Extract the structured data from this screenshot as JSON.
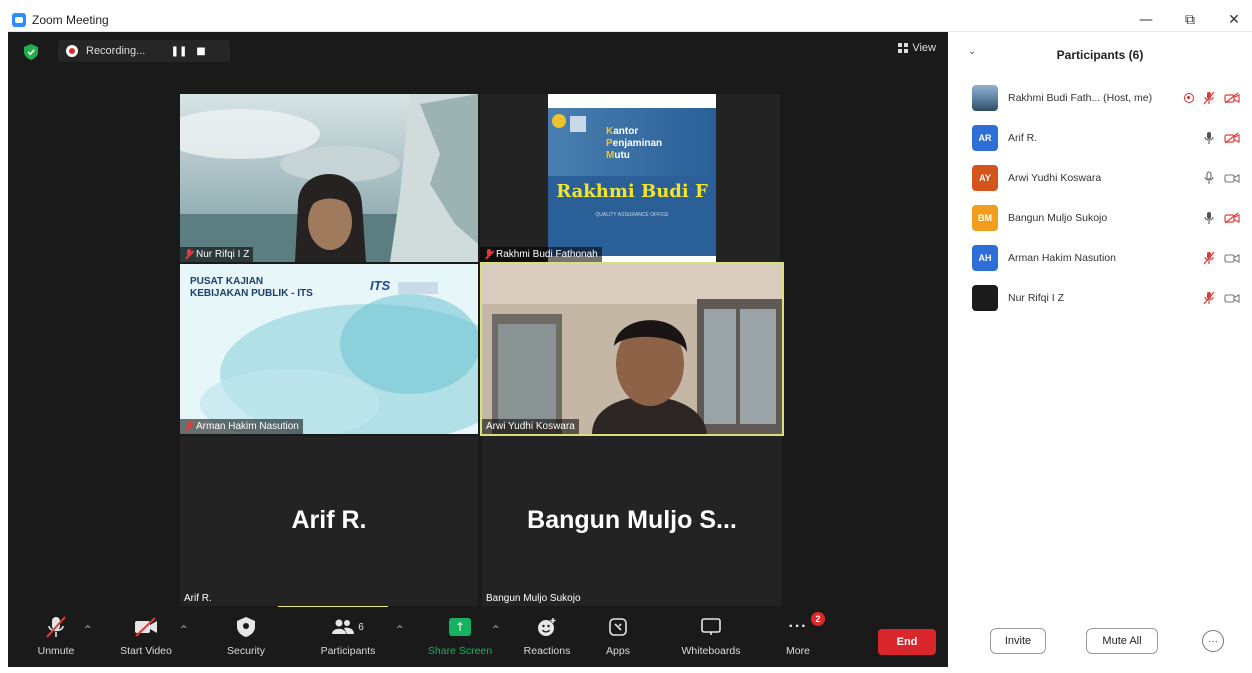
{
  "window": {
    "title": "Zoom Meeting",
    "controls": {
      "minimize": "—",
      "restore": "⧉",
      "close": "✕"
    }
  },
  "topbar": {
    "recording_label": "Recording...",
    "pause_glyph": "❚❚",
    "stop_glyph": "■",
    "view_label": "View"
  },
  "tiles": [
    {
      "id": "nur",
      "name_label": "Nur Rifqi I Z",
      "muted": true
    },
    {
      "id": "rakhmi",
      "name_label": "Rakhmi Budi Fathonah",
      "muted": true,
      "slide": {
        "line1": "antor",
        "line2": "enjaminan",
        "line3": "utu",
        "caps": [
          "K",
          "P",
          "M"
        ],
        "banner": "Rakhmi Budi F",
        "sub": "QUALITY ASSURANCE OFFICE"
      }
    },
    {
      "id": "arman",
      "name_label": "Arman Hakim Nasution",
      "muted": true,
      "slide": {
        "heading1": "PUSAT KAJIAN",
        "heading2": "KEBIJAKAN PUBLIK - ITS",
        "logo": "ITS"
      }
    },
    {
      "id": "arwi",
      "name_label": "Arwi Yudhi Koswara",
      "muted": false,
      "active_speaker": true
    },
    {
      "id": "arif",
      "name_label": "Arif R.",
      "big_name": "Arif R.",
      "muted": false
    },
    {
      "id": "bangun",
      "name_label": "Bangun Muljo Sukojo",
      "big_name": "Bangun  Muljo  S...",
      "muted": false
    }
  ],
  "toolbar": {
    "unmute": "Unmute",
    "start_video": "Start Video",
    "security": "Security",
    "participants": "Participants",
    "participants_count": "6",
    "share_screen": "Share Screen",
    "reactions": "Reactions",
    "apps": "Apps",
    "whiteboards": "Whiteboards",
    "more": "More",
    "more_badge": "2",
    "end": "End"
  },
  "panel": {
    "title": "Participants (6)",
    "participants": [
      {
        "initials": "",
        "name": "Rakhmi Budi Fath...  (Host, me)",
        "avatar_color": "#5b7f9e",
        "recording": true,
        "mic": "muted",
        "video": "off"
      },
      {
        "initials": "AR",
        "name": "Arif R.",
        "avatar_color": "#2d6fd6",
        "recording": false,
        "mic": "on",
        "video": "off"
      },
      {
        "initials": "AY",
        "name": "Arwi Yudhi Koswara",
        "avatar_color": "#d4541c",
        "recording": false,
        "mic": "on-outline",
        "video": "on"
      },
      {
        "initials": "BM",
        "name": "Bangun Muljo Sukojo",
        "avatar_color": "#f29d1e",
        "recording": false,
        "mic": "on",
        "video": "off"
      },
      {
        "initials": "AH",
        "name": "Arman Hakim Nasution",
        "avatar_color": "#2d6fd6",
        "recording": false,
        "mic": "muted",
        "video": "on"
      },
      {
        "initials": "",
        "name": "Nur Rifqi I Z",
        "avatar_color": "#1b1b1b",
        "recording": false,
        "mic": "muted",
        "video": "on"
      }
    ],
    "invite": "Invite",
    "mute_all": "Mute All",
    "more_glyph": "···"
  },
  "colors": {
    "accent_green": "#13b35f",
    "end_red": "#d9262a",
    "speaker_border": "#d7e07a",
    "muted_red": "#e03b3b"
  }
}
